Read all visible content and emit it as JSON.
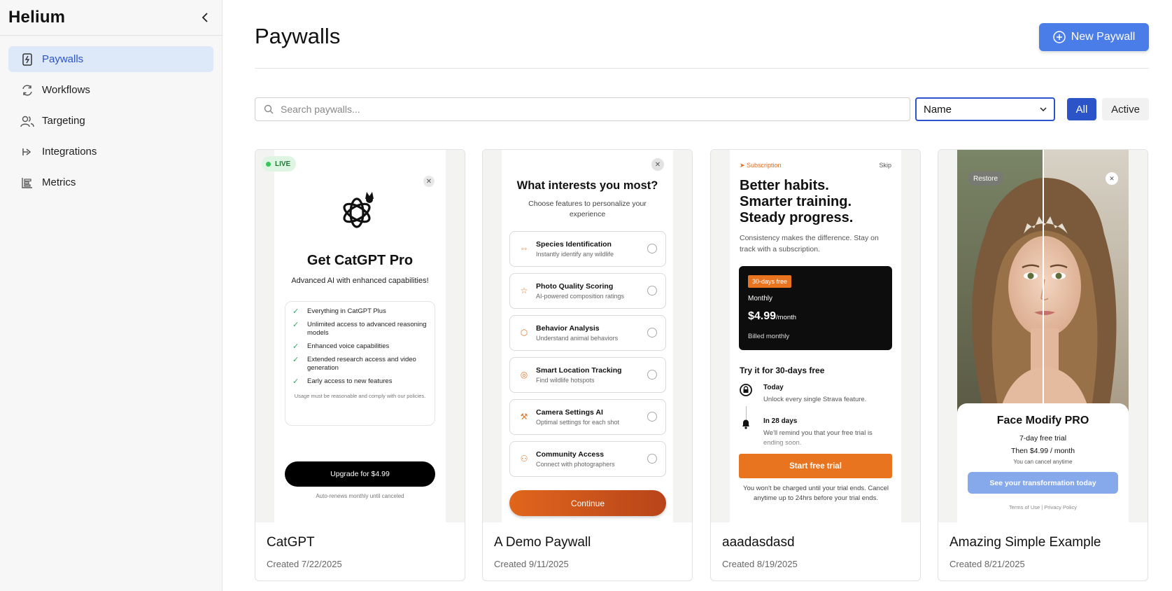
{
  "sidebar": {
    "logo": "Helium",
    "items": [
      {
        "label": "Paywalls",
        "icon": "paywall-icon",
        "active": true
      },
      {
        "label": "Workflows",
        "icon": "refresh-icon",
        "active": false
      },
      {
        "label": "Targeting",
        "icon": "users-icon",
        "active": false
      },
      {
        "label": "Integrations",
        "icon": "integrations-icon",
        "active": false
      },
      {
        "label": "Metrics",
        "icon": "metrics-icon",
        "active": false
      }
    ]
  },
  "header": {
    "title": "Paywalls",
    "new_button": "New Paywall"
  },
  "filters": {
    "search_placeholder": "Search paywalls...",
    "sort_value": "Name",
    "all_label": "All",
    "active_label": "Active"
  },
  "colors": {
    "accent": "#2c54c9",
    "new_button": "#4a7de8",
    "live_green": "#34c759",
    "orange": "#e9741f"
  },
  "cards": [
    {
      "name": "CatGPT",
      "created": "Created 7/22/2025",
      "live": true,
      "live_label": "LIVE",
      "preview": {
        "title": "Get CatGPT Pro",
        "subtitle": "Advanced AI with enhanced capabilities!",
        "features": [
          "Everything in CatGPT Plus",
          "Unlimited access to advanced reasoning models",
          "Enhanced voice capabilities",
          "Extended research access and video generation",
          "Early access to new features"
        ],
        "note": "Usage must be reasonable and comply with our policies.",
        "button": "Upgrade for $4.99",
        "renew": "Auto-renews monthly until canceled"
      }
    },
    {
      "name": "A Demo Paywall",
      "created": "Created 9/11/2025",
      "preview": {
        "title": "What interests you most?",
        "subtitle": "Choose features to personalize your experience",
        "options": [
          {
            "title": "Species Identification",
            "desc": "Instantly identify any wildlife",
            "icon": "binoculars-icon"
          },
          {
            "title": "Photo Quality Scoring",
            "desc": "AI-powered composition ratings",
            "icon": "star-icon"
          },
          {
            "title": "Behavior Analysis",
            "desc": "Understand animal behaviors",
            "icon": "cube-icon"
          },
          {
            "title": "Smart Location Tracking",
            "desc": "Find wildlife hotspots",
            "icon": "target-icon"
          },
          {
            "title": "Camera Settings AI",
            "desc": "Optimal settings for each shot",
            "icon": "wrench-icon"
          },
          {
            "title": "Community Access",
            "desc": "Connect with photographers",
            "icon": "people-icon"
          }
        ],
        "button": "Continue"
      }
    },
    {
      "name": "aaadasdasd",
      "created": "Created 8/19/2025",
      "preview": {
        "subscription": "➤ Subscription",
        "skip": "Skip",
        "headline": [
          "Better habits.",
          "Smarter training.",
          "Steady progress."
        ],
        "desc": "Consistency makes the difference. Stay on track with a subscription.",
        "tag": "30-days free",
        "plan": "Monthly",
        "price": "$4.99",
        "per": "/month",
        "billed": "Billed monthly",
        "try": "Try it for 30-days free",
        "step1_title": "Today",
        "step1_desc": "Unlock every single Strava feature.",
        "step2_title": "In 28 days",
        "step2_desc": "We'll remind you that your free trial is ending soon.",
        "button": "Start free trial",
        "note": "You won't be charged until your trial ends. Cancel anytime up to 24hrs before your trial ends."
      }
    },
    {
      "name": "Amazing Simple Example",
      "created": "Created 8/21/2025",
      "preview": {
        "restore": "Restore",
        "title": "Face Modify PRO",
        "trial": "7-day free trial",
        "then": "Then $4.99 / month",
        "cancel": "You can cancel anytime",
        "button": "See your transformation today",
        "links": "Terms of Use  |  Privacy Policy"
      }
    }
  ]
}
